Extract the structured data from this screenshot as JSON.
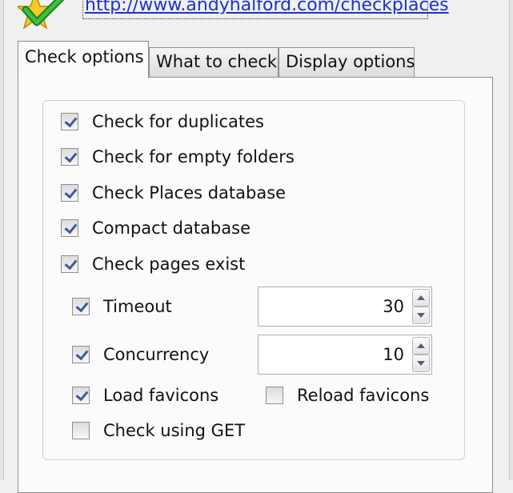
{
  "header": {
    "link": "http://www.andyhalford.com/checkplaces",
    "logo_icon": "checkmark-star-icon"
  },
  "tabs": [
    {
      "label": "Check options",
      "active": true
    },
    {
      "label": "What to check",
      "active": false
    },
    {
      "label": "Display options",
      "active": false
    }
  ],
  "options": {
    "duplicates": {
      "label": "Check for duplicates",
      "checked": true
    },
    "empty_folders": {
      "label": "Check for empty folders",
      "checked": true
    },
    "places_db": {
      "label": "Check Places database",
      "checked": true
    },
    "compact_db": {
      "label": "Compact database",
      "checked": true
    },
    "pages_exist": {
      "label": "Check pages exist",
      "checked": true
    },
    "timeout": {
      "label": "Timeout",
      "checked": true,
      "value": "30"
    },
    "concurrency": {
      "label": "Concurrency",
      "checked": true,
      "value": "10"
    },
    "load_favicons": {
      "label": "Load favicons",
      "checked": true
    },
    "reload_favicons": {
      "label": "Reload favicons",
      "checked": false
    },
    "check_get": {
      "label": "Check using GET",
      "checked": false
    }
  },
  "colors": {
    "link": "#1a33c8",
    "check": "#3d5a98"
  }
}
